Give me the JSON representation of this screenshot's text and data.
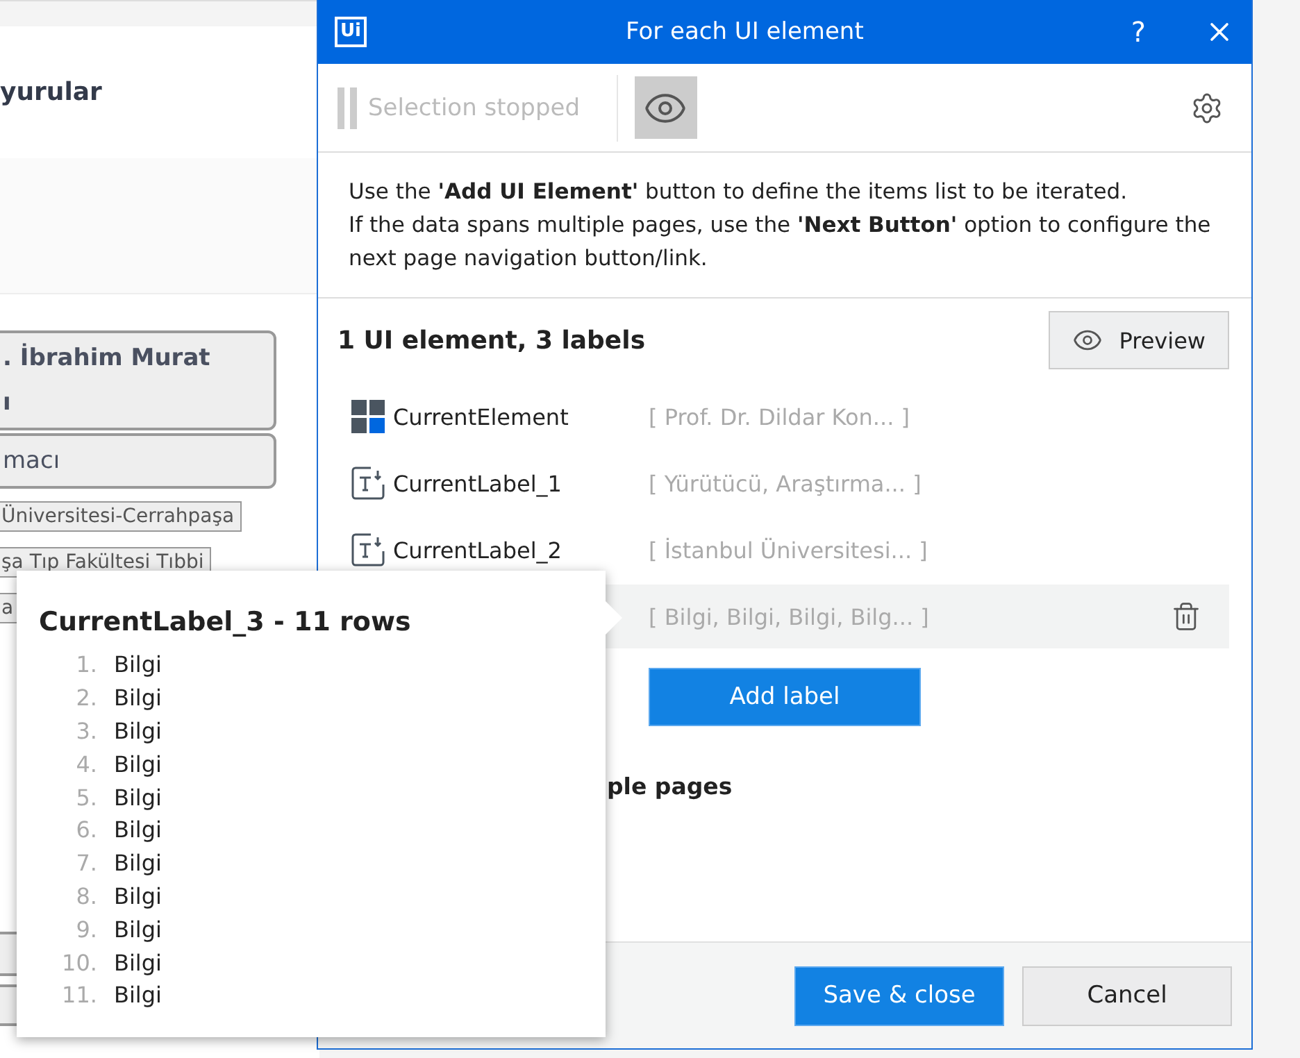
{
  "background_page": {
    "heading": "yurular",
    "name_card": [
      ". İbrahim Murat",
      "ı"
    ],
    "role_card": "macı",
    "tags": [
      "Üniversitesi-Cerrahpaşa",
      "şa Tıp Fakültesi Tıbbi",
      "a"
    ]
  },
  "dialog": {
    "logo": "Ui",
    "title": "For each UI element",
    "help": "?",
    "toolbar": {
      "status": "Selection stopped",
      "highlight_on": true
    },
    "instructions": [
      "Use the **'Add UI Element'** button to define the items list to be iterated.",
      "If the data spans multiple pages, use the **'Next Button'** option to configure the next page navigation button/link."
    ],
    "summary": "1 UI element, 3 labels",
    "preview_button": "Preview",
    "items": [
      {
        "kind": "element",
        "name": "CurrentElement",
        "value": "[ Prof. Dr. Dildar Kon...  ]",
        "selected": false
      },
      {
        "kind": "label",
        "name": "CurrentLabel_1",
        "value": "[ Yürütücü, Araştırma... ]",
        "selected": false
      },
      {
        "kind": "label",
        "name": "CurrentLabel_2",
        "value": "[ İstanbul Üniversitesi... ]",
        "selected": false
      },
      {
        "value": "[ Bilgi, Bilgi, Bilgi, Bilg... ]",
        "selected": true
      }
    ],
    "add_label_button": "Add label",
    "pages_option": "ple pages",
    "buttons": [
      {
        "label": "Save & close",
        "primary": true
      },
      {
        "label": "Cancel",
        "primary": false
      }
    ]
  },
  "popup": {
    "title": "CurrentLabel_3",
    "count": "- 11 rows",
    "rows": [
      {
        "number": "1.",
        "value": "Bilgi"
      },
      {
        "number": "2.",
        "value": "Bilgi"
      },
      {
        "number": "3.",
        "value": "Bilgi"
      },
      {
        "number": "4.",
        "value": "Bilgi"
      },
      {
        "number": "5.",
        "value": "Bilgi"
      },
      {
        "number": "6.",
        "value": "Bilgi"
      },
      {
        "number": "7.",
        "value": "Bilgi"
      },
      {
        "number": "8.",
        "value": "Bilgi"
      },
      {
        "number": "9.",
        "value": "Bilgi"
      },
      {
        "number": "10.",
        "value": "Bilgi"
      },
      {
        "number": "11.",
        "value": "Bilgi"
      }
    ]
  }
}
